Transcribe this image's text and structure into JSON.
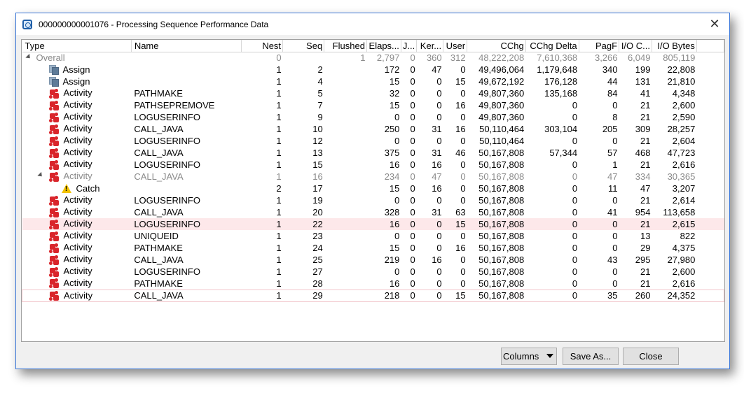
{
  "window": {
    "title": "000000000001076 - Processing Sequence Performance Data",
    "close_glyph": "✕"
  },
  "columns": [
    "Type",
    "Name",
    "Nest",
    "Seq",
    "Flushed",
    "Elaps...",
    "J...",
    "Ker...",
    "User",
    "CChg",
    "CChg Delta",
    "PagF",
    "I/O C...",
    "I/O Bytes"
  ],
  "rows": [
    {
      "type": "Overall",
      "icon": "",
      "name": "",
      "nest": "0",
      "seq": "",
      "flushed": "1",
      "elapsed": "2,797",
      "j": "0",
      "ker": "360",
      "user": "312",
      "cchg": "48,222,208",
      "cchg_delta": "7,610,368",
      "pagf": "3,266",
      "ioc": "6,049",
      "iobytes": "805,119",
      "dim": true,
      "expander": true,
      "indent": 0
    },
    {
      "type": "Assign",
      "icon": "assign-icon",
      "name": "",
      "nest": "1",
      "seq": "2",
      "flushed": "",
      "elapsed": "172",
      "j": "0",
      "ker": "47",
      "user": "0",
      "cchg": "49,496,064",
      "cchg_delta": "1,179,648",
      "pagf": "340",
      "ioc": "199",
      "iobytes": "22,808",
      "indent": 1
    },
    {
      "type": "Assign",
      "icon": "assign-icon",
      "name": "",
      "nest": "1",
      "seq": "4",
      "flushed": "",
      "elapsed": "15",
      "j": "0",
      "ker": "0",
      "user": "15",
      "cchg": "49,672,192",
      "cchg_delta": "176,128",
      "pagf": "44",
      "ioc": "131",
      "iobytes": "21,810",
      "indent": 1
    },
    {
      "type": "Activity",
      "icon": "activity-icon",
      "name": "PATHMAKE",
      "nest": "1",
      "seq": "5",
      "flushed": "",
      "elapsed": "32",
      "j": "0",
      "ker": "0",
      "user": "0",
      "cchg": "49,807,360",
      "cchg_delta": "135,168",
      "pagf": "84",
      "ioc": "41",
      "iobytes": "4,348",
      "indent": 1
    },
    {
      "type": "Activity",
      "icon": "activity-icon",
      "name": "PATHSEPREMOVE",
      "nest": "1",
      "seq": "7",
      "flushed": "",
      "elapsed": "15",
      "j": "0",
      "ker": "0",
      "user": "16",
      "cchg": "49,807,360",
      "cchg_delta": "0",
      "pagf": "0",
      "ioc": "21",
      "iobytes": "2,600",
      "indent": 1
    },
    {
      "type": "Activity",
      "icon": "activity-icon",
      "name": "LOGUSERINFO",
      "nest": "1",
      "seq": "9",
      "flushed": "",
      "elapsed": "0",
      "j": "0",
      "ker": "0",
      "user": "0",
      "cchg": "49,807,360",
      "cchg_delta": "0",
      "pagf": "8",
      "ioc": "21",
      "iobytes": "2,590",
      "indent": 1
    },
    {
      "type": "Activity",
      "icon": "activity-icon",
      "name": "CALL_JAVA",
      "nest": "1",
      "seq": "10",
      "flushed": "",
      "elapsed": "250",
      "j": "0",
      "ker": "31",
      "user": "16",
      "cchg": "50,110,464",
      "cchg_delta": "303,104",
      "pagf": "205",
      "ioc": "309",
      "iobytes": "28,257",
      "indent": 1
    },
    {
      "type": "Activity",
      "icon": "activity-icon",
      "name": "LOGUSERINFO",
      "nest": "1",
      "seq": "12",
      "flushed": "",
      "elapsed": "0",
      "j": "0",
      "ker": "0",
      "user": "0",
      "cchg": "50,110,464",
      "cchg_delta": "0",
      "pagf": "0",
      "ioc": "21",
      "iobytes": "2,604",
      "indent": 1
    },
    {
      "type": "Activity",
      "icon": "activity-icon",
      "name": "CALL_JAVA",
      "nest": "1",
      "seq": "13",
      "flushed": "",
      "elapsed": "375",
      "j": "0",
      "ker": "31",
      "user": "46",
      "cchg": "50,167,808",
      "cchg_delta": "57,344",
      "pagf": "57",
      "ioc": "468",
      "iobytes": "47,723",
      "indent": 1
    },
    {
      "type": "Activity",
      "icon": "activity-icon",
      "name": "LOGUSERINFO",
      "nest": "1",
      "seq": "15",
      "flushed": "",
      "elapsed": "16",
      "j": "0",
      "ker": "16",
      "user": "0",
      "cchg": "50,167,808",
      "cchg_delta": "0",
      "pagf": "1",
      "ioc": "21",
      "iobytes": "2,616",
      "indent": 1
    },
    {
      "type": "Activity",
      "icon": "activity-icon",
      "name": "CALL_JAVA",
      "nest": "1",
      "seq": "16",
      "flushed": "",
      "elapsed": "234",
      "j": "0",
      "ker": "47",
      "user": "0",
      "cchg": "50,167,808",
      "cchg_delta": "0",
      "pagf": "47",
      "ioc": "334",
      "iobytes": "30,365",
      "dim": true,
      "expander": true,
      "indent": 1
    },
    {
      "type": "Catch",
      "icon": "warning-icon",
      "name": "",
      "nest": "2",
      "seq": "17",
      "flushed": "",
      "elapsed": "15",
      "j": "0",
      "ker": "16",
      "user": "0",
      "cchg": "50,167,808",
      "cchg_delta": "0",
      "pagf": "11",
      "ioc": "47",
      "iobytes": "3,207",
      "indent": 2
    },
    {
      "type": "Activity",
      "icon": "activity-icon",
      "name": "LOGUSERINFO",
      "nest": "1",
      "seq": "19",
      "flushed": "",
      "elapsed": "0",
      "j": "0",
      "ker": "0",
      "user": "0",
      "cchg": "50,167,808",
      "cchg_delta": "0",
      "pagf": "0",
      "ioc": "21",
      "iobytes": "2,614",
      "indent": 1
    },
    {
      "type": "Activity",
      "icon": "activity-icon",
      "name": "CALL_JAVA",
      "nest": "1",
      "seq": "20",
      "flushed": "",
      "elapsed": "328",
      "j": "0",
      "ker": "31",
      "user": "63",
      "cchg": "50,167,808",
      "cchg_delta": "0",
      "pagf": "41",
      "ioc": "954",
      "iobytes": "113,658",
      "indent": 1
    },
    {
      "type": "Activity",
      "icon": "activity-icon",
      "name": "LOGUSERINFO",
      "nest": "1",
      "seq": "22",
      "flushed": "",
      "elapsed": "16",
      "j": "0",
      "ker": "0",
      "user": "15",
      "cchg": "50,167,808",
      "cchg_delta": "0",
      "pagf": "0",
      "ioc": "21",
      "iobytes": "2,615",
      "selected": true,
      "indent": 1
    },
    {
      "type": "Activity",
      "icon": "activity-icon",
      "name": "UNIQUEID",
      "nest": "1",
      "seq": "23",
      "flushed": "",
      "elapsed": "0",
      "j": "0",
      "ker": "0",
      "user": "0",
      "cchg": "50,167,808",
      "cchg_delta": "0",
      "pagf": "0",
      "ioc": "13",
      "iobytes": "822",
      "indent": 1
    },
    {
      "type": "Activity",
      "icon": "activity-icon",
      "name": "PATHMAKE",
      "nest": "1",
      "seq": "24",
      "flushed": "",
      "elapsed": "15",
      "j": "0",
      "ker": "0",
      "user": "16",
      "cchg": "50,167,808",
      "cchg_delta": "0",
      "pagf": "0",
      "ioc": "29",
      "iobytes": "4,375",
      "indent": 1
    },
    {
      "type": "Activity",
      "icon": "activity-icon",
      "name": "CALL_JAVA",
      "nest": "1",
      "seq": "25",
      "flushed": "",
      "elapsed": "219",
      "j": "0",
      "ker": "16",
      "user": "0",
      "cchg": "50,167,808",
      "cchg_delta": "0",
      "pagf": "43",
      "ioc": "295",
      "iobytes": "27,980",
      "indent": 1
    },
    {
      "type": "Activity",
      "icon": "activity-icon",
      "name": "LOGUSERINFO",
      "nest": "1",
      "seq": "27",
      "flushed": "",
      "elapsed": "0",
      "j": "0",
      "ker": "0",
      "user": "0",
      "cchg": "50,167,808",
      "cchg_delta": "0",
      "pagf": "0",
      "ioc": "21",
      "iobytes": "2,600",
      "indent": 1
    },
    {
      "type": "Activity",
      "icon": "activity-icon",
      "name": "PATHMAKE",
      "nest": "1",
      "seq": "28",
      "flushed": "",
      "elapsed": "16",
      "j": "0",
      "ker": "0",
      "user": "0",
      "cchg": "50,167,808",
      "cchg_delta": "0",
      "pagf": "0",
      "ioc": "21",
      "iobytes": "2,616",
      "indent": 1
    },
    {
      "type": "Activity",
      "icon": "activity-icon",
      "name": "CALL_JAVA",
      "nest": "1",
      "seq": "29",
      "flushed": "",
      "elapsed": "218",
      "j": "0",
      "ker": "0",
      "user": "15",
      "cchg": "50,167,808",
      "cchg_delta": "0",
      "pagf": "35",
      "ioc": "260",
      "iobytes": "24,352",
      "focused": true,
      "indent": 1
    }
  ],
  "buttons": {
    "columns": "Columns",
    "save_as": "Save As...",
    "close": "Close"
  }
}
